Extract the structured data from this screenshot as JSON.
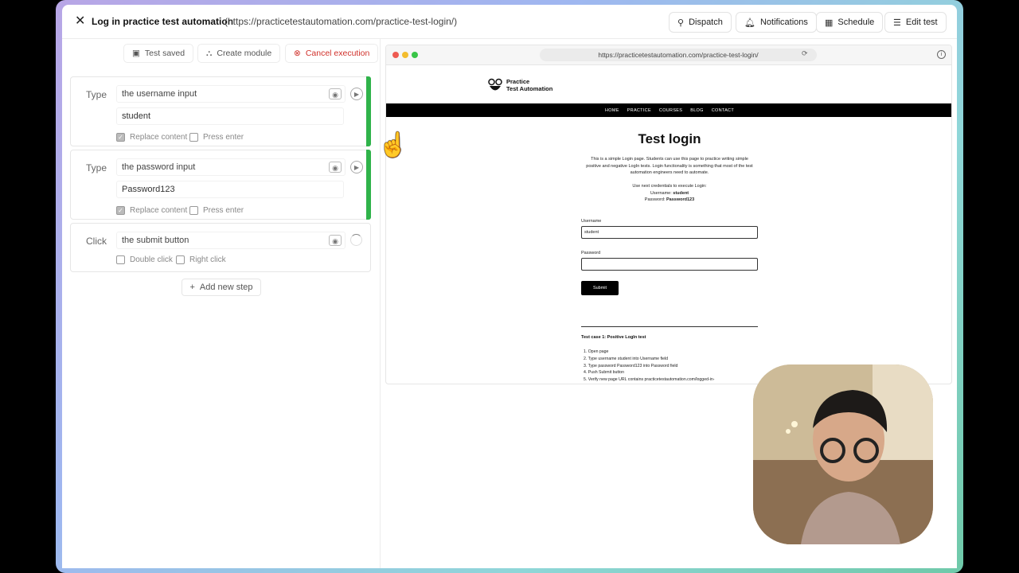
{
  "header": {
    "title": "Log in practice test automation",
    "url": "(https://practicetestautomation.com/practice-test-login/)",
    "buttons": {
      "dispatch": "Dispatch",
      "notifications": "Notifications",
      "schedule": "Schedule",
      "edit": "Edit test"
    }
  },
  "toolbar": {
    "saved": "Test saved",
    "module": "Create module",
    "cancel": "Cancel execution"
  },
  "steps": [
    {
      "kind": "Type",
      "target": "the username input",
      "value": "student",
      "opt1": "Replace content",
      "opt2": "Press enter",
      "opt1_checked": true,
      "opt2_checked": false
    },
    {
      "kind": "Type",
      "target": "the password input",
      "value": "Password123",
      "opt1": "Replace content",
      "opt2": "Press enter",
      "opt1_checked": true,
      "opt2_checked": false
    },
    {
      "kind": "Click",
      "target": "the submit button",
      "opt1": "Double click",
      "opt2": "Right click",
      "opt1_checked": false,
      "opt2_checked": false
    }
  ],
  "add_step": "Add new step",
  "browser": {
    "address": "https://practicetestautomation.com/practice-test-login/",
    "logo_line1": "Practice",
    "logo_line2": "Test Automation",
    "nav": [
      "HOME",
      "PRACTICE",
      "COURSES",
      "BLOG",
      "CONTACT"
    ],
    "heading": "Test login",
    "intro": "This is a simple Login page. Students can use this page to practice writing simple positive and negative LogIn tests. Login functionality is something that most of the test automation engineers need to automate.",
    "creds_intro": "Use next credentials to execute Login:",
    "creds_user_label": "Username:",
    "creds_user": "student",
    "creds_pass_label": "Password:",
    "creds_pass": "Password123",
    "username_label": "Username",
    "username_value": "student",
    "password_label": "Password",
    "password_value": "",
    "submit": "Submit",
    "testcase_title": "Test case 1: Positive LogIn test",
    "testcase_steps": [
      "1. Open page",
      "2. Type username student into Username field",
      "3. Type password Password123 into Password field",
      "4. Push Submit button",
      "5. Verify new page URL contains practicetestautomation.com/logged-in-"
    ]
  },
  "colors": {
    "accent_green": "#2fb34a",
    "cancel_red": "#d0302a",
    "nav_black": "#000000"
  }
}
